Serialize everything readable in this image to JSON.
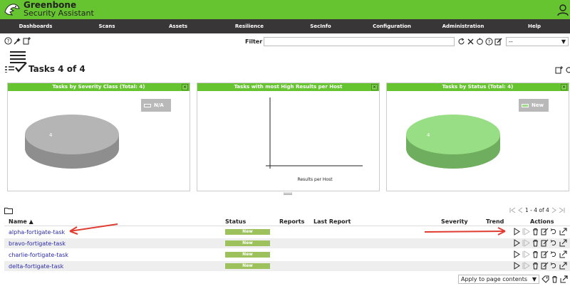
{
  "app": {
    "brand_line1": "Greenbone",
    "brand_line2": "Security Assistant",
    "accent": "#66c430"
  },
  "nav": {
    "items": [
      "Dashboards",
      "Scans",
      "Assets",
      "Resilience",
      "SecInfo",
      "Configuration",
      "Administration",
      "Help"
    ]
  },
  "filter": {
    "label": "Filter",
    "value": "",
    "select_value": "--"
  },
  "page": {
    "title": "Tasks 4 of 4"
  },
  "panels": [
    {
      "title": "Tasks by Severity Class (Total: 4)",
      "legend": "N/A",
      "pie_label": "4",
      "color": "#b5b5b5",
      "dark": "#8e8e8e"
    },
    {
      "title": "Tasks with most High Results per Host",
      "xlabel": "Results per Host"
    },
    {
      "title": "Tasks by Status (Total: 4)",
      "legend": "New",
      "pie_label": "4",
      "color": "#98de85",
      "dark": "#6fae5e"
    }
  ],
  "pager": {
    "text": "1 - 4 of 4"
  },
  "table": {
    "headers": {
      "name": "Name ▲",
      "status": "Status",
      "reports": "Reports",
      "last_report": "Last Report",
      "severity": "Severity",
      "trend": "Trend",
      "actions": "Actions"
    },
    "rows": [
      {
        "name": "alpha-fortigate-task",
        "status": "New"
      },
      {
        "name": "bravo-fortigate-task",
        "status": "New"
      },
      {
        "name": "charlie-fortigate-task",
        "status": "New"
      },
      {
        "name": "delta-fortigate-task",
        "status": "New"
      }
    ]
  },
  "bulk": {
    "select_value": "Apply to page contents"
  },
  "colors": {
    "nav_bg": "#393637",
    "status_new": "#9dc15d",
    "link": "#2a2aa8",
    "annotation_arrow": "#e03c31"
  },
  "icons": [
    "help-icon",
    "wizard-icon",
    "new-task-icon",
    "refresh-icon",
    "reset-filter-icon",
    "edit-filter-icon",
    "start-icon",
    "delete-icon",
    "edit-icon",
    "clone-icon",
    "export-icon",
    "user-icon"
  ]
}
